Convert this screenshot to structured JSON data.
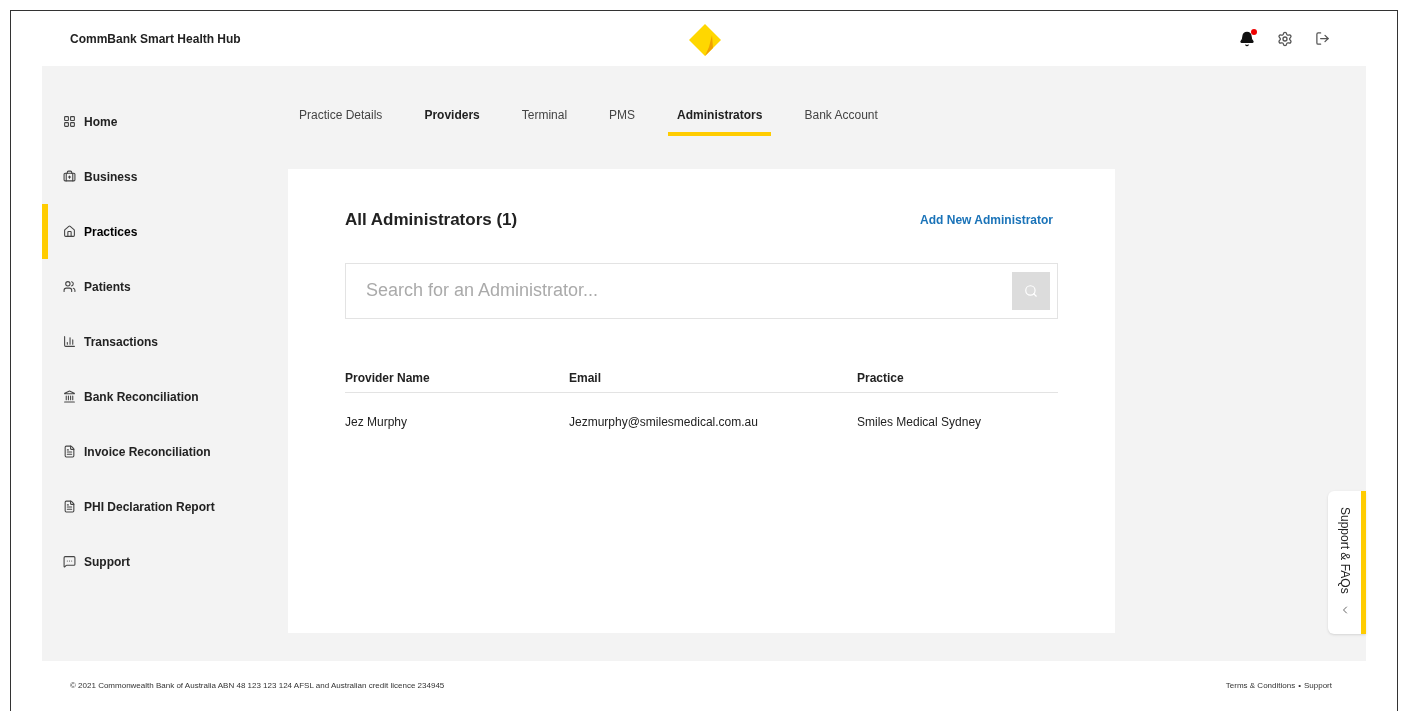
{
  "header": {
    "title": "CommBank Smart Health Hub",
    "notifications": {
      "unread": true
    }
  },
  "sidebar": {
    "items": [
      {
        "label": "Home",
        "selected": false
      },
      {
        "label": "Business",
        "selected": false
      },
      {
        "label": "Practices",
        "selected": true
      },
      {
        "label": "Patients",
        "selected": false
      },
      {
        "label": "Transactions",
        "selected": false
      },
      {
        "label": "Bank Reconciliation",
        "selected": false
      },
      {
        "label": "Invoice Reconciliation",
        "selected": false
      },
      {
        "label": "PHI Declaration Report",
        "selected": false
      },
      {
        "label": "Support",
        "selected": false
      }
    ]
  },
  "tabs": [
    {
      "label": "Practice Details",
      "selected": false,
      "bold": false
    },
    {
      "label": "Providers",
      "selected": false,
      "bold": true
    },
    {
      "label": "Terminal",
      "selected": false,
      "bold": false
    },
    {
      "label": "PMS",
      "selected": false,
      "bold": false
    },
    {
      "label": "Administrators",
      "selected": true,
      "bold": true
    },
    {
      "label": "Bank Account",
      "selected": false,
      "bold": false
    }
  ],
  "panel": {
    "title": "All Administrators (1)",
    "add_link": "Add New Administrator",
    "search": {
      "placeholder": "Search for an Administrator..."
    },
    "table": {
      "columns": [
        "Provider Name",
        "Email",
        "Practice"
      ],
      "rows": [
        [
          "Jez Murphy",
          "Jezmurphy@smilesmedical.com.au",
          "Smiles Medical Sydney"
        ]
      ]
    }
  },
  "support_tab": {
    "label": "Support & FAQs"
  },
  "footer": {
    "copyright": "© 2021 Commonwealth Bank of Australia ABN 48 123 123 124 AFSL and Australian credit licence 234945",
    "links": [
      "Terms & Conditions",
      "Support"
    ],
    "separator": "•"
  }
}
